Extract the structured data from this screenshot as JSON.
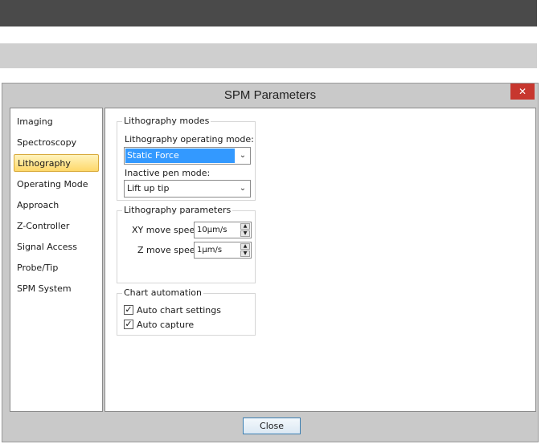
{
  "dialog": {
    "title": "SPM Parameters",
    "close_glyph": "✕"
  },
  "nav": {
    "items": [
      {
        "label": "Imaging"
      },
      {
        "label": "Spectroscopy"
      },
      {
        "label": "Lithography",
        "active": true
      },
      {
        "label": "Operating Mode"
      },
      {
        "label": "Approach"
      },
      {
        "label": "Z-Controller"
      },
      {
        "label": "Signal Access"
      },
      {
        "label": "Probe/Tip"
      },
      {
        "label": "SPM System"
      }
    ]
  },
  "lithography_modes": {
    "legend": "Lithography modes",
    "operating_mode_label": "Lithography operating mode:",
    "operating_mode_value": "Static Force",
    "inactive_pen_label": "Inactive pen mode:",
    "inactive_pen_value": "Lift up tip"
  },
  "lithography_parameters": {
    "legend": "Lithography parameters",
    "xy_label": "XY move speed",
    "xy_value": "10µm/s",
    "z_label": "Z move speed",
    "z_value": "1µm/s"
  },
  "chart_automation": {
    "legend": "Chart automation",
    "auto_chart_label": "Auto chart settings",
    "auto_chart_checked": true,
    "auto_capture_label": "Auto capture",
    "auto_capture_checked": true
  },
  "footer": {
    "close_label": "Close"
  }
}
